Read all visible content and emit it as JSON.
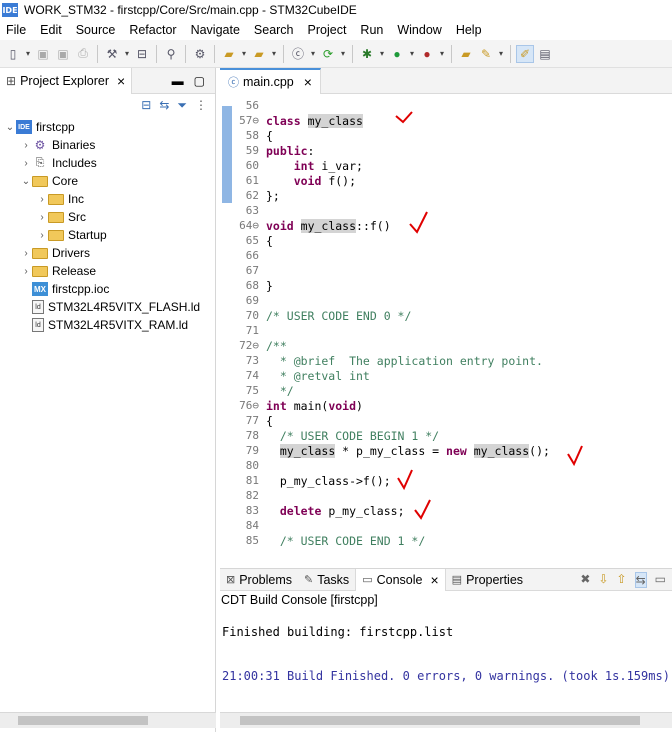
{
  "window": {
    "app_icon": "IDE",
    "title": "WORK_STM32 - firstcpp/Core/Src/main.cpp - STM32CubeIDE"
  },
  "menu": [
    "File",
    "Edit",
    "Source",
    "Refactor",
    "Navigate",
    "Search",
    "Project",
    "Run",
    "Window",
    "Help"
  ],
  "toolbar_icons": [
    "new-icon",
    "save-icon",
    "save-all-icon",
    "print-icon",
    "build-icon",
    "debug-settings-icon",
    "binary-icon",
    "link-icon",
    "debug-tool-icon",
    "new-folder-icon",
    "new-source-icon",
    "new-class-icon",
    "refresh-icon",
    "debug-icon",
    "run-icon",
    "external-tools-icon",
    "open-perspective-icon",
    "mark-icon",
    "highlight-icon"
  ],
  "project_explorer": {
    "tab_label": "Project Explorer",
    "tree": [
      {
        "label": "firstcpp",
        "icon": "project-icon",
        "icon_text": "IDE",
        "indent": 0,
        "chevron": "⌄"
      },
      {
        "label": "Binaries",
        "icon": "binaries-icon",
        "icon_text": "⚙",
        "indent": 1,
        "chevron": "›"
      },
      {
        "label": "Includes",
        "icon": "includes-icon",
        "icon_text": "⎘",
        "indent": 1,
        "chevron": "›"
      },
      {
        "label": "Core",
        "icon": "folder-icon",
        "icon_text": "",
        "indent": 1,
        "chevron": "⌄"
      },
      {
        "label": "Inc",
        "icon": "folder-icon",
        "icon_text": "",
        "indent": 2,
        "chevron": "›"
      },
      {
        "label": "Src",
        "icon": "folder-icon",
        "icon_text": "",
        "indent": 2,
        "chevron": "›"
      },
      {
        "label": "Startup",
        "icon": "folder-icon",
        "icon_text": "",
        "indent": 2,
        "chevron": "›"
      },
      {
        "label": "Drivers",
        "icon": "folder-icon",
        "icon_text": "",
        "indent": 1,
        "chevron": "›"
      },
      {
        "label": "Release",
        "icon": "folder-icon",
        "icon_text": "",
        "indent": 1,
        "chevron": "›"
      },
      {
        "label": "firstcpp.ioc",
        "icon": "mx-file-icon",
        "icon_text": "MX",
        "indent": 1,
        "chevron": ""
      },
      {
        "label": "STM32L4R5VITX_FLASH.ld",
        "icon": "ld-file-icon",
        "icon_text": "ld",
        "indent": 1,
        "chevron": ""
      },
      {
        "label": "STM32L4R5VITX_RAM.ld",
        "icon": "ld-file-icon",
        "icon_text": "ld",
        "indent": 1,
        "chevron": ""
      }
    ]
  },
  "editor": {
    "tab_label": "main.cpp",
    "lines": [
      {
        "n": "56",
        "t": ""
      },
      {
        "n": "57⊖",
        "t": "class my_class"
      },
      {
        "n": "58",
        "t": "{"
      },
      {
        "n": "59",
        "t": "public:"
      },
      {
        "n": "60",
        "t": "    int i_var;"
      },
      {
        "n": "61",
        "t": "    void f();"
      },
      {
        "n": "62",
        "t": "};"
      },
      {
        "n": "63",
        "t": ""
      },
      {
        "n": "64⊖",
        "t": "void my_class::f()"
      },
      {
        "n": "65",
        "t": "{"
      },
      {
        "n": "66",
        "t": ""
      },
      {
        "n": "67",
        "t": ""
      },
      {
        "n": "68",
        "t": "}"
      },
      {
        "n": "69",
        "t": ""
      },
      {
        "n": "70",
        "t": "/* USER CODE END 0 */"
      },
      {
        "n": "71",
        "t": ""
      },
      {
        "n": "72⊖",
        "t": "/**"
      },
      {
        "n": "73",
        "t": "  * @brief  The application entry point."
      },
      {
        "n": "74",
        "t": "  * @retval int"
      },
      {
        "n": "75",
        "t": "  */"
      },
      {
        "n": "76⊖",
        "t": "int main(void)"
      },
      {
        "n": "77",
        "t": "{"
      },
      {
        "n": "78",
        "t": "  /* USER CODE BEGIN 1 */"
      },
      {
        "n": "79",
        "t": "  my_class * p_my_class = new my_class();"
      },
      {
        "n": "80",
        "t": ""
      },
      {
        "n": "81",
        "t": "  p_my_class->f();"
      },
      {
        "n": "82",
        "t": ""
      },
      {
        "n": "83",
        "t": "  delete p_my_class;"
      },
      {
        "n": "84",
        "t": ""
      },
      {
        "n": "85",
        "t": "  /* USER CODE END 1 */"
      }
    ]
  },
  "bottom_panel": {
    "tabs": [
      "Problems",
      "Tasks",
      "Console",
      "Properties"
    ],
    "active_tab": "Console",
    "console_title": "CDT Build Console [firstcpp]",
    "console_lines": [
      "Finished building: firstcpp.list",
      "21:00:31 Build Finished. 0 errors, 0 warnings. (took 1s.159ms)"
    ]
  },
  "colors": {
    "keyword": "#7f0055",
    "comment": "#3f7f5f",
    "annotation_check": "#e00000",
    "console_finished": "#3333a0"
  }
}
